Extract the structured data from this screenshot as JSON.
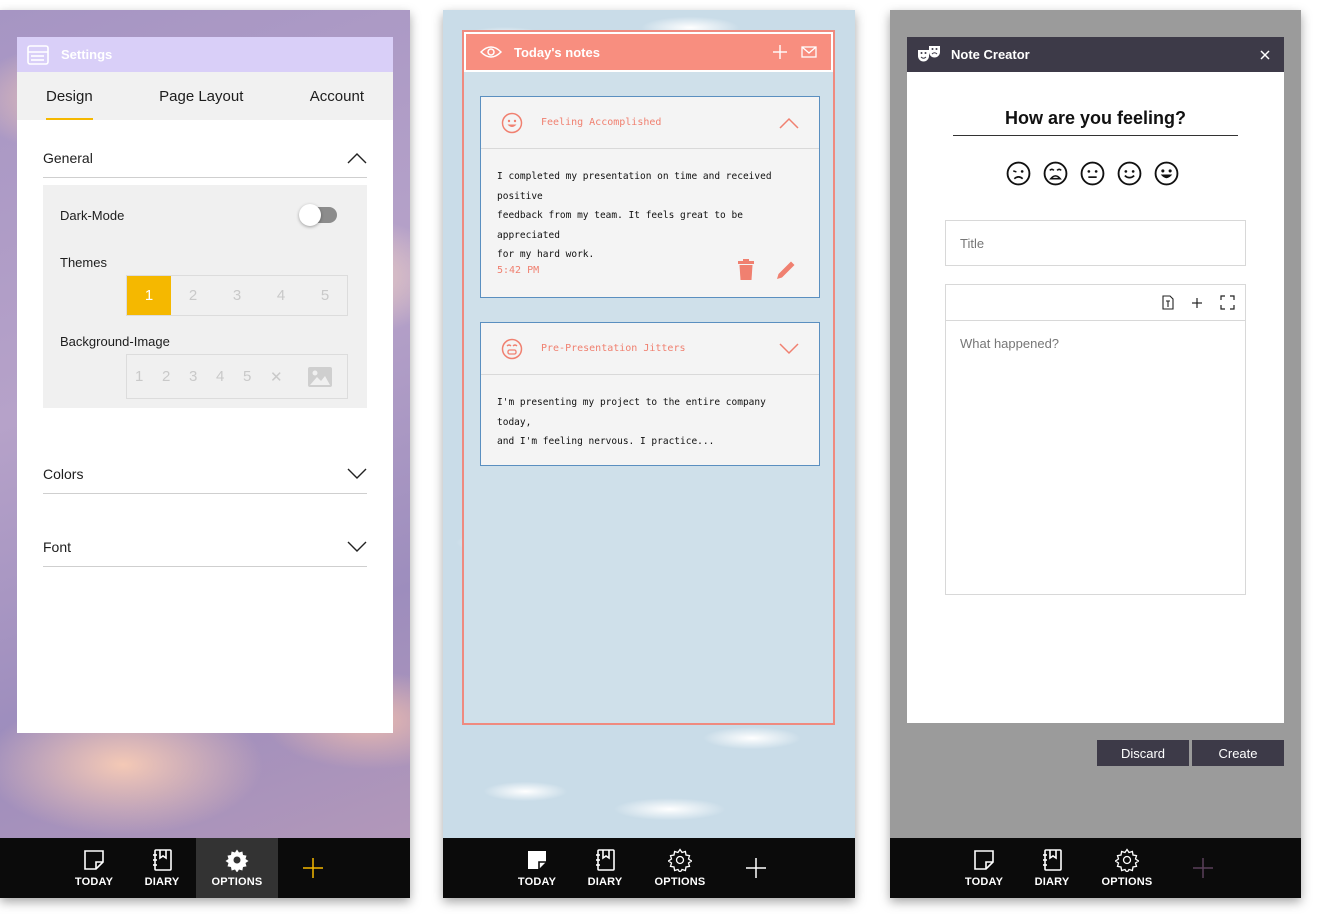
{
  "settings": {
    "header_title": "Settings",
    "tabs": [
      {
        "label": "Design",
        "active": true
      },
      {
        "label": "Page Layout",
        "active": false
      },
      {
        "label": "Account",
        "active": false
      }
    ],
    "general": {
      "title": "General",
      "dark_mode_label": "Dark-Mode",
      "dark_mode_on": false,
      "themes_label": "Themes",
      "themes": [
        "1",
        "2",
        "3",
        "4",
        "5"
      ],
      "selected_theme": "1",
      "bg_label": "Background-Image",
      "bg_options": [
        "1",
        "2",
        "3",
        "4",
        "5",
        "✕"
      ]
    },
    "colors_title": "Colors",
    "font_title": "Font",
    "accent_color": "#f5b800"
  },
  "notes": {
    "header_title": "Today's notes",
    "accent_color": "#f88e7f",
    "cards": [
      {
        "title": "Feeling Accomplished",
        "mood_icon": "happy-face-icon",
        "lines": [
          "I completed my presentation on time and received positive",
          "feedback from my team. It feels great to be appreciated",
          "for my hard work."
        ],
        "time": "5:42 PM",
        "expanded": true
      },
      {
        "title": "Pre-Presentation Jitters",
        "mood_icon": "anxious-face-icon",
        "lines": [
          "I'm presenting my project to the entire company today,",
          "and I'm feeling nervous. I practice..."
        ],
        "expanded": false
      }
    ]
  },
  "creator": {
    "header_title": "Note Creator",
    "question": "How are you feeling?",
    "moods": [
      "sad-face-icon",
      "crying-face-icon",
      "neutral-face-icon",
      "smile-face-icon",
      "grin-face-icon"
    ],
    "title_placeholder": "Title",
    "body_placeholder": "What happened?",
    "discard_label": "Discard",
    "create_label": "Create"
  },
  "nav": {
    "today": "TODAY",
    "diary": "DIARY",
    "options": "OPTIONS"
  }
}
